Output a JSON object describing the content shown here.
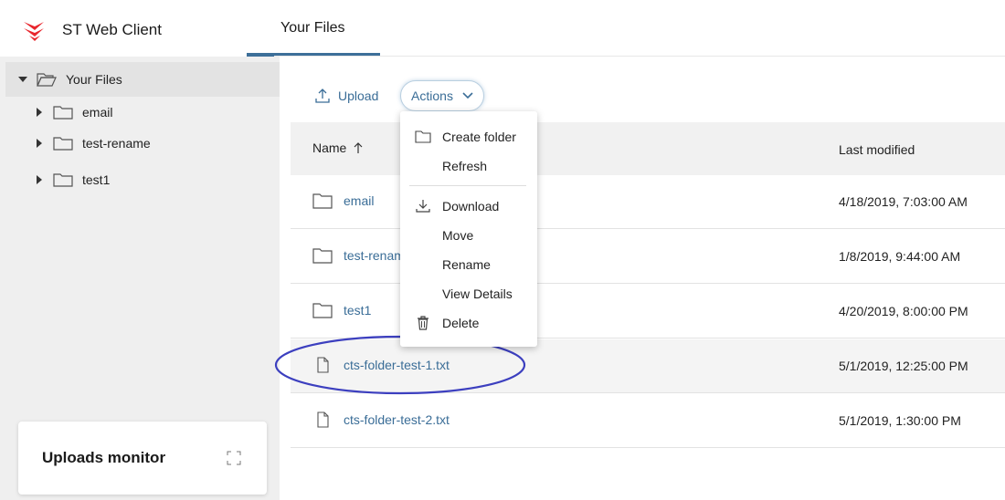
{
  "app": {
    "title": "ST Web Client",
    "brand_color": "#e8262d",
    "accent": "#3a6d97"
  },
  "header": {
    "tab_label": "Your Files"
  },
  "sidebar": {
    "root_label": "Your Files",
    "items": [
      {
        "label": "email"
      },
      {
        "label": "test-rename"
      },
      {
        "label": "test1"
      }
    ],
    "uploads_monitor": {
      "title": "Uploads monitor"
    }
  },
  "toolbar": {
    "upload_label": "Upload",
    "actions_label": "Actions"
  },
  "table": {
    "columns": {
      "name": "Name",
      "last_modified": "Last modified"
    },
    "rows": [
      {
        "type": "folder",
        "name": "email",
        "modified": "4/18/2019, 7:03:00 AM"
      },
      {
        "type": "folder",
        "name": "test-renam",
        "modified": "1/8/2019, 9:44:00 AM"
      },
      {
        "type": "folder",
        "name": "test1",
        "modified": "4/20/2019, 8:00:00 PM"
      },
      {
        "type": "file",
        "name": "cts-folder-test-1.txt",
        "modified": "5/1/2019, 12:25:00 PM"
      },
      {
        "type": "file",
        "name": "cts-folder-test-2.txt",
        "modified": "5/1/2019, 1:30:00 PM"
      }
    ]
  },
  "actions_menu": {
    "items": [
      {
        "label": "Create folder",
        "icon": "folder-icon"
      },
      {
        "label": "Refresh",
        "icon": ""
      },
      {
        "label": "Download",
        "icon": "download-icon"
      },
      {
        "label": "Move",
        "icon": ""
      },
      {
        "label": "Rename",
        "icon": ""
      },
      {
        "label": "View Details",
        "icon": ""
      },
      {
        "label": "Delete",
        "icon": "trash-icon"
      }
    ]
  }
}
